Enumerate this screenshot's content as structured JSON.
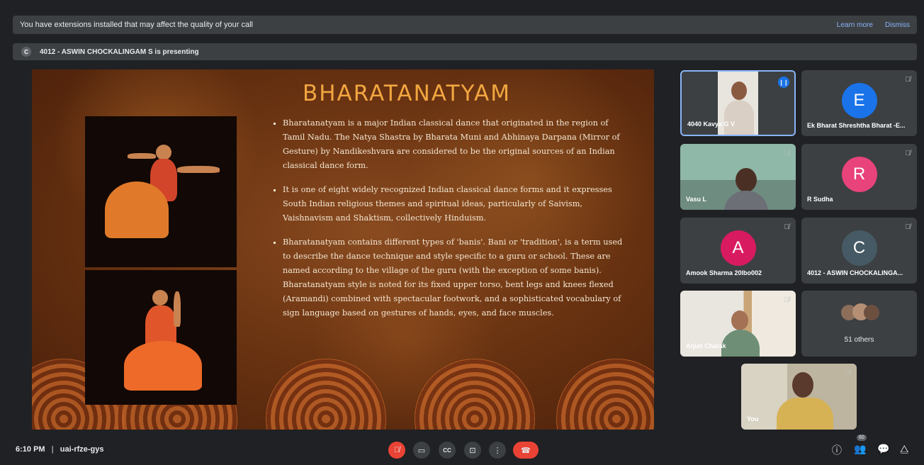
{
  "extension_bar": {
    "message": "You have extensions installed that may affect the quality of your call",
    "learn_more": "Learn more",
    "dismiss": "Dismiss"
  },
  "presenting_bar": {
    "avatar_letter": "C",
    "text": "4012 - ASWIN CHOCKALINGAM S is presenting"
  },
  "slide": {
    "title": "BHARATANATYAM",
    "bullets": [
      "Bharatanatyam is a major Indian classical dance that originated in the region of Tamil Nadu. The Natya Shastra by Bharata Muni and Abhinaya Darpana (Mirror of Gesture) by Nandikeshvara are considered to be the original sources of an Indian classical dance form.",
      "It is one of eight widely recognized Indian classical dance forms and it expresses South Indian religious themes and spiritual ideas, particularly of Saivism, Vaishnavism and Shaktism, collectively Hinduism.",
      "Bharatanatyam contains different types of 'banis'. Bani or 'tradition', is a term used to describe the dance technique and style specific to a guru or school. These are named according to the village of the guru (with the exception of some banis). Bharatanatyam style is noted for its fixed upper torso, bent legs and knees flexed (Aramandi) combined with spectacular footwork, and a sophisticated vocabulary of sign language based on gestures of hands, eyes, and face muscles."
    ]
  },
  "participants": [
    {
      "name": "4040 Kavya G V",
      "type": "video",
      "speaking": true
    },
    {
      "name": "Ek Bharat Shreshtha Bharat -E...",
      "type": "avatar",
      "letter": "E",
      "color": "#1a73e8"
    },
    {
      "name": "Vasu L",
      "type": "video"
    },
    {
      "name": "R Sudha",
      "type": "avatar",
      "letter": "R",
      "color": "#e8437a"
    },
    {
      "name": "Amook Sharma 20lbo002",
      "type": "avatar",
      "letter": "A",
      "color": "#d81b60"
    },
    {
      "name": "4012 - ASWIN CHOCKALINGA...",
      "type": "avatar",
      "letter": "C",
      "color": "#455a64"
    },
    {
      "name": "Arjun Charak",
      "type": "video"
    },
    {
      "name": "51 others",
      "type": "others"
    },
    {
      "name": "You",
      "type": "video"
    }
  ],
  "bottom_bar": {
    "time": "6:10 PM",
    "meeting_code": "uai-rfze-gys",
    "people_count": "60",
    "captions_label": "CC"
  },
  "colors": {
    "end_call": "#ea4335",
    "mic_off": "#ea4335",
    "accent": "#8ab4f8"
  }
}
